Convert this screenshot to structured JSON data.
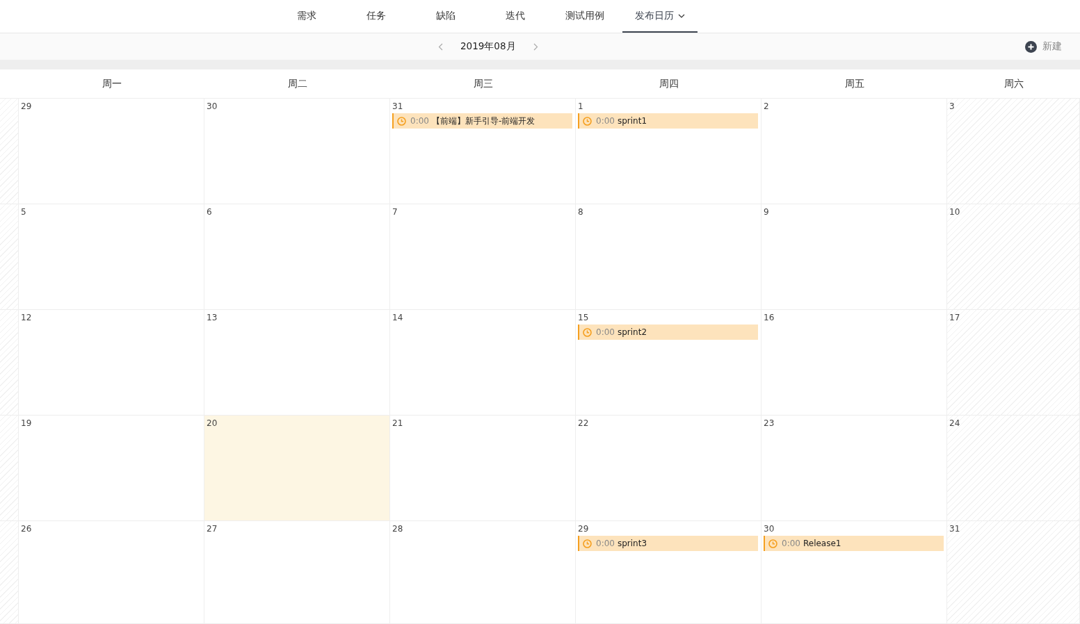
{
  "tabs": [
    {
      "label": "需求",
      "selected": false,
      "dropdown": false
    },
    {
      "label": "任务",
      "selected": false,
      "dropdown": false
    },
    {
      "label": "缺陷",
      "selected": false,
      "dropdown": false
    },
    {
      "label": "迭代",
      "selected": false,
      "dropdown": false
    },
    {
      "label": "测试用例",
      "selected": false,
      "dropdown": false
    },
    {
      "label": "发布日历",
      "selected": true,
      "dropdown": true
    }
  ],
  "toolbar": {
    "month": "2019年08月",
    "new_button": "新建"
  },
  "weekdays": [
    "周一",
    "周二",
    "周三",
    "周四",
    "周五",
    "周六"
  ],
  "weeks": [
    [
      {
        "day": "29",
        "today": false,
        "weekend": false
      },
      {
        "day": "30",
        "today": false,
        "weekend": false
      },
      {
        "day": "31",
        "today": false,
        "weekend": false,
        "events": [
          {
            "time": "0:00",
            "title": "【前端】新手引导-前端开发"
          }
        ]
      },
      {
        "day": "1",
        "today": false,
        "weekend": false,
        "events": [
          {
            "time": "0:00",
            "title": "sprint1"
          }
        ]
      },
      {
        "day": "2",
        "today": false,
        "weekend": false
      },
      {
        "day": "3",
        "today": false,
        "weekend": true
      }
    ],
    [
      {
        "day": "5",
        "today": false,
        "weekend": false
      },
      {
        "day": "6",
        "today": false,
        "weekend": false
      },
      {
        "day": "7",
        "today": false,
        "weekend": false
      },
      {
        "day": "8",
        "today": false,
        "weekend": false
      },
      {
        "day": "9",
        "today": false,
        "weekend": false
      },
      {
        "day": "10",
        "today": false,
        "weekend": true
      }
    ],
    [
      {
        "day": "12",
        "today": false,
        "weekend": false
      },
      {
        "day": "13",
        "today": false,
        "weekend": false
      },
      {
        "day": "14",
        "today": false,
        "weekend": false
      },
      {
        "day": "15",
        "today": false,
        "weekend": false,
        "events": [
          {
            "time": "0:00",
            "title": "sprint2"
          }
        ]
      },
      {
        "day": "16",
        "today": false,
        "weekend": false
      },
      {
        "day": "17",
        "today": false,
        "weekend": true
      }
    ],
    [
      {
        "day": "19",
        "today": false,
        "weekend": false
      },
      {
        "day": "20",
        "today": true,
        "weekend": false
      },
      {
        "day": "21",
        "today": false,
        "weekend": false
      },
      {
        "day": "22",
        "today": false,
        "weekend": false
      },
      {
        "day": "23",
        "today": false,
        "weekend": false
      },
      {
        "day": "24",
        "today": false,
        "weekend": true
      }
    ],
    [
      {
        "day": "26",
        "today": false,
        "weekend": false
      },
      {
        "day": "27",
        "today": false,
        "weekend": false
      },
      {
        "day": "28",
        "today": false,
        "weekend": false
      },
      {
        "day": "29",
        "today": false,
        "weekend": false,
        "events": [
          {
            "time": "0:00",
            "title": "sprint3"
          }
        ]
      },
      {
        "day": "30",
        "today": false,
        "weekend": false,
        "events": [
          {
            "time": "0:00",
            "title": "Release1"
          }
        ]
      },
      {
        "day": "31",
        "today": false,
        "weekend": true
      }
    ]
  ]
}
